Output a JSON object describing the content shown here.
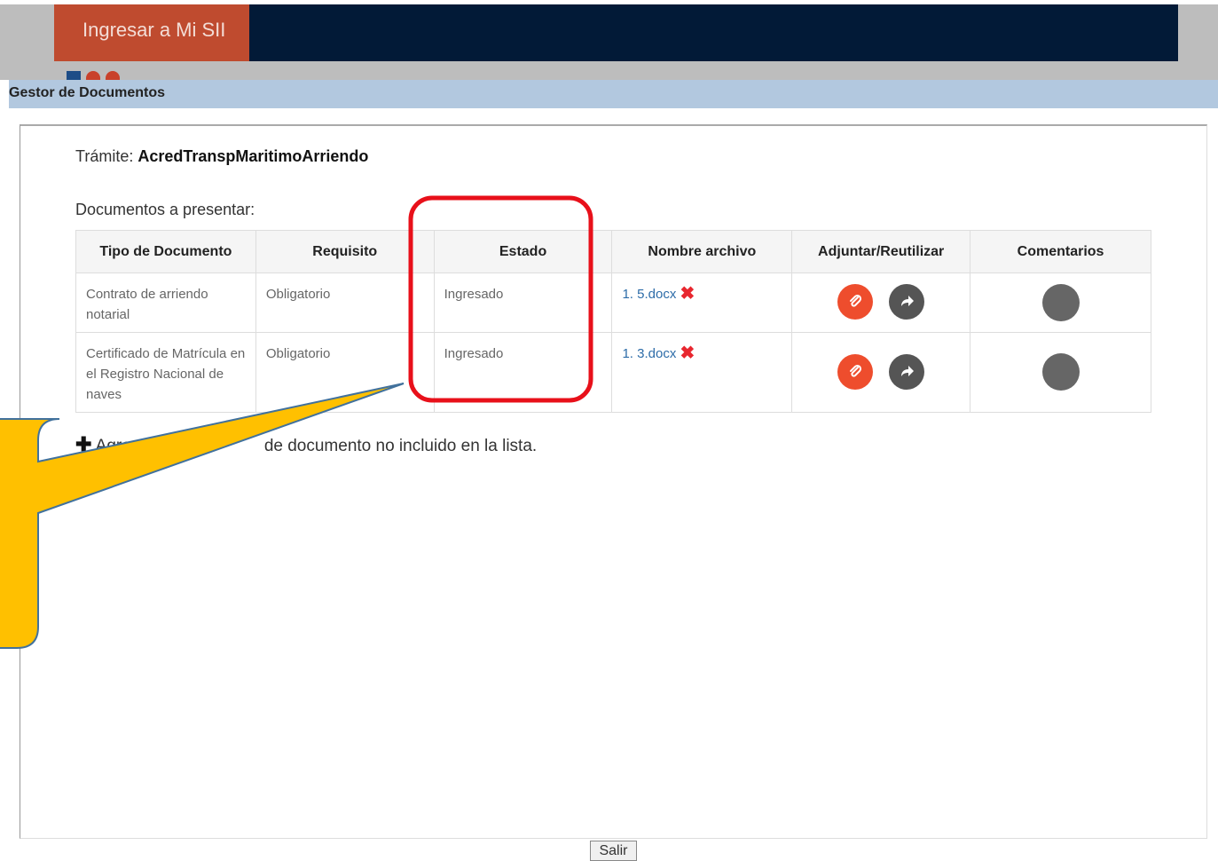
{
  "header": {
    "login_button": "Ingresar a Mi SII",
    "section_title": "Gestor de Documentos"
  },
  "tramite": {
    "label": "Trámite:",
    "value": "AcredTranspMaritimoArriendo"
  },
  "documents": {
    "label": "Documentos a presentar:",
    "columns": [
      "Tipo de Documento",
      "Requisito",
      "Estado",
      "Nombre archivo",
      "Adjuntar/Reutilizar",
      "Comentarios"
    ],
    "rows": [
      {
        "tipo": "Contrato de arriendo notarial",
        "requisito": "Obligatorio",
        "estado": "Ingresado",
        "archivo": "1. 5.docx"
      },
      {
        "tipo": "Certificado de Matrícula en el Registro Nacional de naves",
        "requisito": "Obligatorio",
        "estado": "Ingresado",
        "archivo": "1. 3.docx"
      }
    ]
  },
  "add_document": {
    "text_start": "Agre",
    "text_end": "de documento no incluido en la lista."
  },
  "footer": {
    "exit_button": "Salir"
  },
  "colors": {
    "topbar": "#021a37",
    "login_button": "#bf4b2f",
    "section_bar": "#b2c8df",
    "highlight_box": "#e8101a",
    "callout_fill": "#ffc000",
    "callout_stroke": "#41719c",
    "attach_icon": "#ee4d2d"
  }
}
